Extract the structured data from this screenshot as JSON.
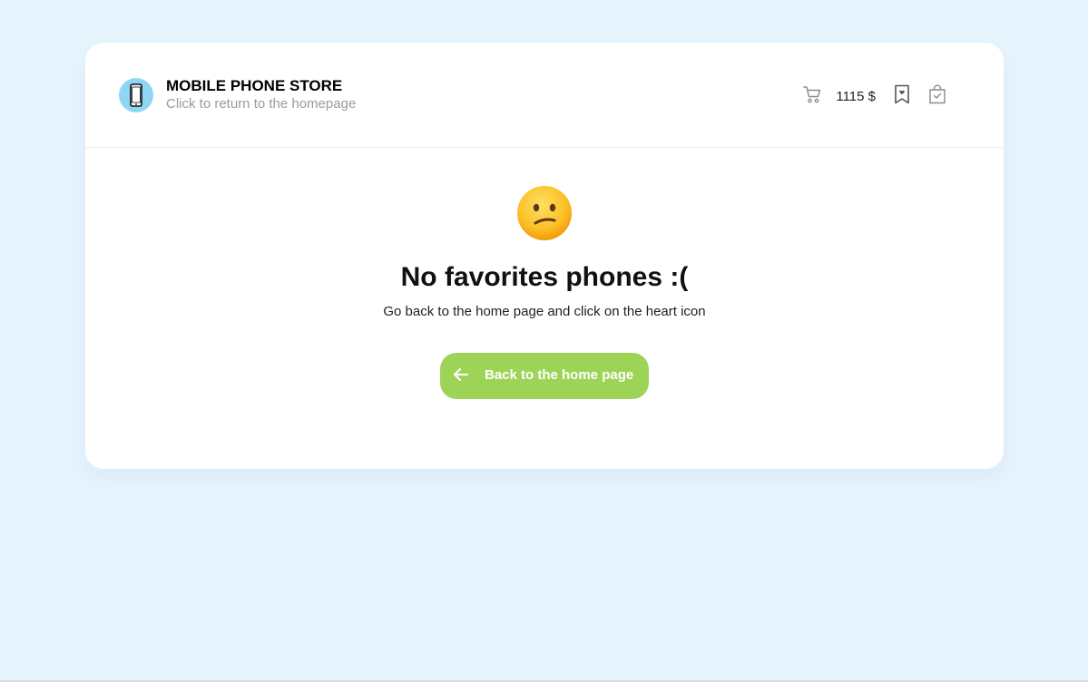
{
  "header": {
    "brand_title": "MOBILE PHONE STORE",
    "brand_subtitle": "Click to return to the homepage",
    "cart_total": "1115 $"
  },
  "icons": {
    "logo": "mobile-phone-icon",
    "cart": "cart-icon",
    "favorites": "bookmark-icon",
    "orders": "shopping-bag-check-icon",
    "emoji": "confused-face-emoji",
    "back": "arrow-left-icon"
  },
  "empty_state": {
    "title": "No favorites phones :(",
    "description": "Go back to the home page and click on the heart icon",
    "button_label": "Back to the home page"
  },
  "colors": {
    "background": "#e6f4fe",
    "card": "#ffffff",
    "accent_button": "#9dd458",
    "logo_circle": "#8fd6f5",
    "muted_text": "#9b9b9b"
  }
}
